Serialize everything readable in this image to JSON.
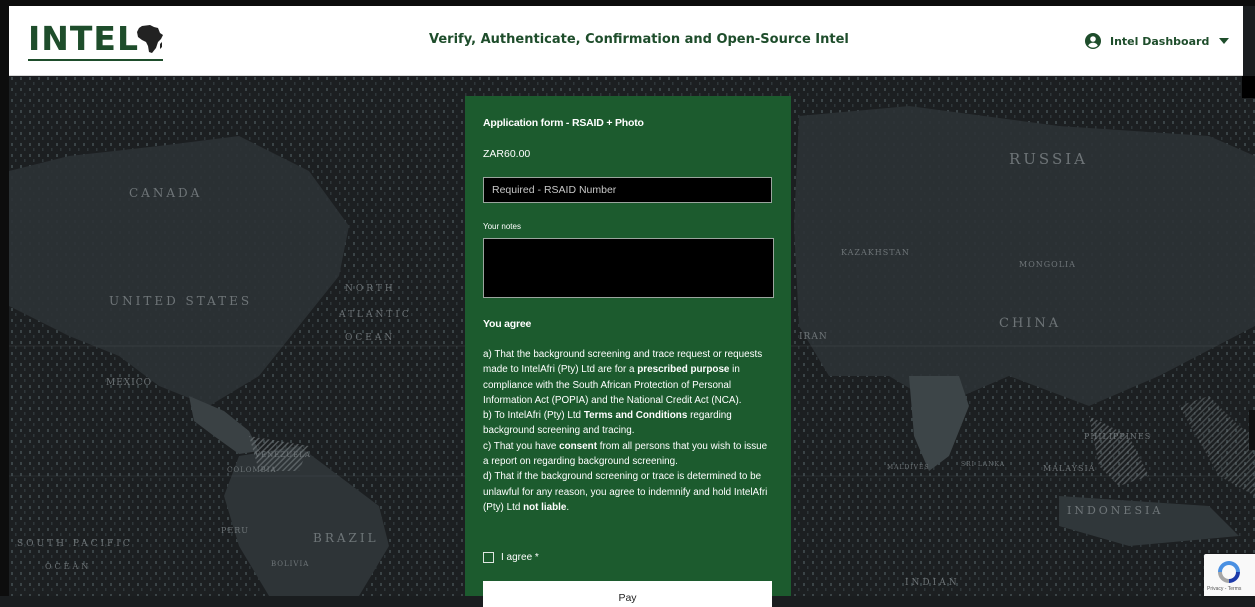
{
  "header": {
    "logo_text": "INTEL",
    "title": "Verify, Authenticate, Confirmation and Open-Source Intel",
    "user_menu_label": "Intel Dashboard"
  },
  "map_labels": {
    "russia": "RUSSIA",
    "china": "CHINA",
    "united_states": "UNITED STATES",
    "canada": "CANADA",
    "north_atlantic": "NORTH",
    "atlantic": "ATLANTIC",
    "ocean": "OCEAN",
    "brazil": "BRAZIL",
    "south_pacific": "SOUTH PACIFIC",
    "south_ocean": "OCEAN",
    "indonesia": "INDONESIA",
    "mongolia": "MONGOLIA",
    "kazakhstan": "KAZAKHSTAN",
    "iran": "IRAN",
    "mexico": "MEXICO",
    "colombia": "COLOMBIA",
    "venezuela": "VENEZUELA",
    "peru": "PERU",
    "bolivia": "BOLIVIA",
    "philippines": "PHILIPPINES",
    "malaysia": "MALAYSIA",
    "sri_lanka": "SRI LANKA",
    "maldives": "MALDIVES",
    "indian": "INDIAN"
  },
  "form": {
    "title": "Application form - RSAID + Photo",
    "price": "ZAR60.00",
    "rsaid_placeholder": "Required - RSAID Number",
    "notes_label": "Your notes",
    "notes_value": "",
    "agree_heading": "You agree",
    "terms": {
      "a_pre": "a) That the background screening and trace request or requests made to IntelAfri (Pty) Ltd are for a ",
      "a_bold": "prescribed purpose",
      "a_post": " in compliance with the South African Protection of Personal Information Act (POPIA) and the National Credit Act (NCA).",
      "b_pre": "b) To IntelAfri (Pty) Ltd ",
      "b_bold": "Terms and Conditions",
      "b_post": " regarding background screening and tracing.",
      "c_pre": "c) That you have ",
      "c_bold": "consent",
      "c_post": " from all persons that you wish to issue a report on regarding background screening.",
      "d_pre": "d) That if the background screening or trace is determined to be unlawful for any reason, you agree to indemnify and hold IntelAfri (Pty) Ltd ",
      "d_bold": "not liable",
      "d_post": "."
    },
    "checkbox_label": "I agree *",
    "checkbox_checked": false,
    "pay_label": "Pay"
  },
  "recaptcha": {
    "links": "Privacy - Terms"
  },
  "colors": {
    "brand_green": "#1e4d2b",
    "card_green": "#1c5b2e",
    "field_bg": "#000000"
  }
}
